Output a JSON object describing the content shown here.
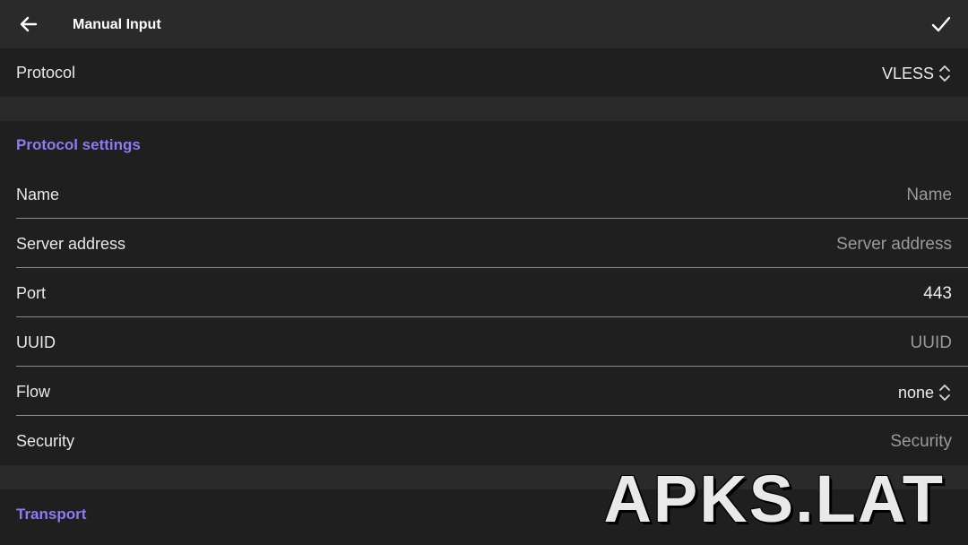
{
  "appbar": {
    "title": "Manual Input",
    "back_icon": "arrow-back-icon",
    "confirm_icon": "check-icon"
  },
  "protocol": {
    "label": "Protocol",
    "value": "VLESS"
  },
  "protocol_settings": {
    "title": "Protocol settings",
    "fields": [
      {
        "label": "Name",
        "value": "",
        "placeholder": "Name"
      },
      {
        "label": "Server address",
        "value": "",
        "placeholder": "Server address"
      },
      {
        "label": "Port",
        "value": "443",
        "placeholder": ""
      },
      {
        "label": "UUID",
        "value": "",
        "placeholder": "UUID"
      }
    ],
    "flow": {
      "label": "Flow",
      "value": "none"
    },
    "security": {
      "label": "Security",
      "placeholder": "Security"
    }
  },
  "transport": {
    "title": "Transport"
  },
  "watermark": "APKS.LAT",
  "colors": {
    "background": "#1f1f1f",
    "appbar": "#2a2a2a",
    "accent": "#8b7cf0",
    "divider": "#8a8a8a"
  }
}
